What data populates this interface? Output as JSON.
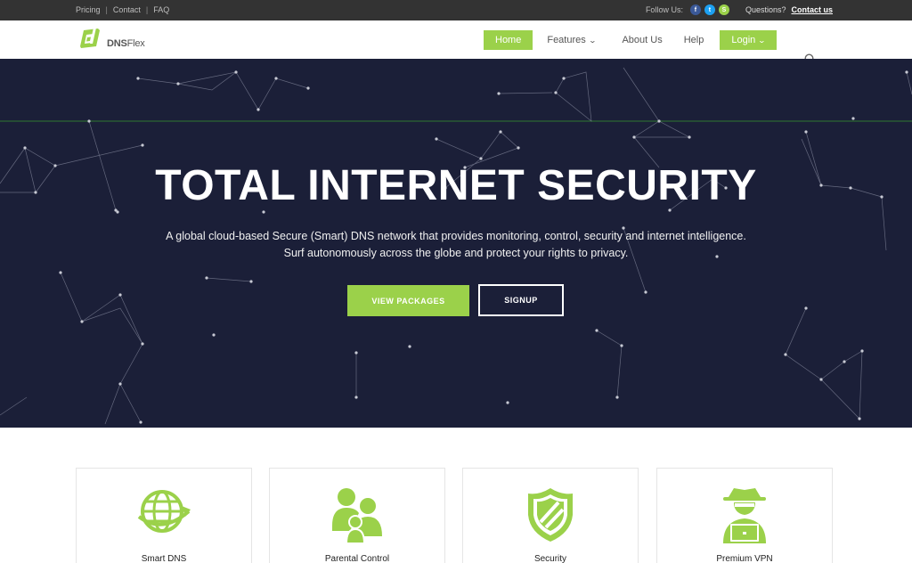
{
  "topbar": {
    "links": [
      "Pricing",
      "Contact",
      "FAQ"
    ],
    "separator": "|",
    "follow_label": "Follow Us:",
    "social": [
      {
        "icon": "facebook-icon",
        "glyph": "f"
      },
      {
        "icon": "twitter-icon",
        "glyph": "t"
      },
      {
        "icon": "skype-icon",
        "glyph": "S"
      }
    ],
    "questions_label": "Questions?",
    "contact_link": "Contact us"
  },
  "brand": {
    "name_bold": "DNS",
    "name_rest": "Flex",
    "logo_mark": "d"
  },
  "nav": {
    "home": "Home",
    "features": "Features",
    "about": "About Us",
    "help": "Help",
    "login": "Login",
    "caret": "⌄"
  },
  "hero": {
    "title": "TOTAL INTERNET SECURITY",
    "subtitle_line1": "A global cloud-based Secure (Smart) DNS network that provides monitoring, control, security and internet intelligence.",
    "subtitle_line2": "Surf autonomously across the globe and protect your rights to privacy.",
    "btn_packages": "VIEW PACKAGES",
    "btn_signup": "SIGNUP"
  },
  "features": [
    {
      "title": "Smart DNS",
      "icon": "globe-icon"
    },
    {
      "title": "Parental Control",
      "icon": "family-icon"
    },
    {
      "title": "Security",
      "icon": "shield-icon"
    },
    {
      "title": "Premium VPN",
      "icon": "spy-laptop-icon"
    }
  ],
  "colors": {
    "accent": "#9bd14a",
    "hero_bg": "#1b1f38",
    "topbar_bg": "#333333"
  }
}
